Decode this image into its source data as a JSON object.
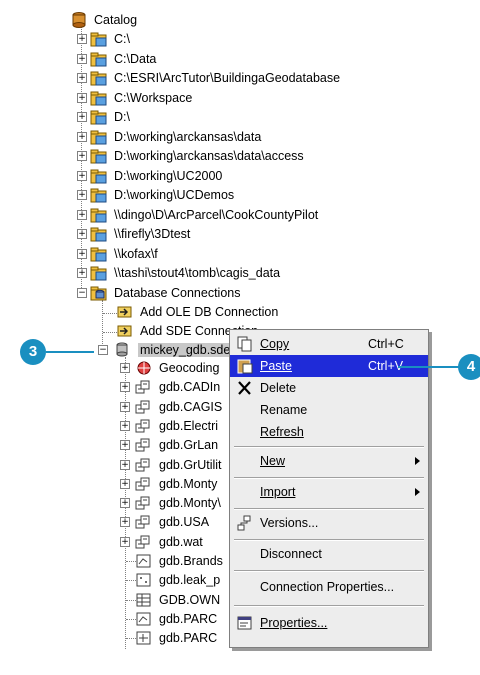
{
  "tree": {
    "root": "Catalog",
    "folders": [
      "C:\\",
      "C:\\Data",
      "C:\\ESRI\\ArcTutor\\BuildingaGeodatabase",
      "C:\\Workspace",
      "D:\\",
      "D:\\working\\arckansas\\data",
      "D:\\working\\arckansas\\data\\access",
      "D:\\working\\UC2000",
      "D:\\working\\UCDemos",
      "\\\\dingo\\D\\ArcParcel\\CookCountyPilot",
      "\\\\firefly\\3Dtest",
      "\\\\kofax\\f",
      "\\\\tashi\\stout4\\tomb\\cagis_data"
    ],
    "db_connections": "Database Connections",
    "add_oledb": "Add OLE DB Connection",
    "add_sde": "Add SDE Connection",
    "selected_connection": "mickey_gdb.sde",
    "children": [
      "Geocoding",
      "gdb.CADIn",
      "gdb.CAGIS",
      "gdb.Electri",
      "gdb.GrLan",
      "gdb.GrUtilit",
      "gdb.Monty",
      "gdb.Monty\\",
      "gdb.USA",
      "gdb.wat",
      "gdb.Brands",
      "gdb.leak_p",
      "GDB.OWN",
      "gdb.PARC",
      "gdb.PARC"
    ]
  },
  "menu": {
    "copy": "Copy",
    "copy_shortcut": "Ctrl+C",
    "paste": "Paste",
    "paste_shortcut": "Ctrl+V",
    "delete": "Delete",
    "rename": "Rename",
    "refresh": "Refresh",
    "new": "New",
    "import": "Import",
    "versions": "Versions...",
    "disconnect": "Disconnect",
    "connection_properties": "Connection Properties...",
    "properties": "Properties..."
  },
  "callouts": {
    "left": "3",
    "right": "4"
  },
  "colors": {
    "highlight": "#1f2bd8",
    "callout": "#1a8fc0"
  }
}
